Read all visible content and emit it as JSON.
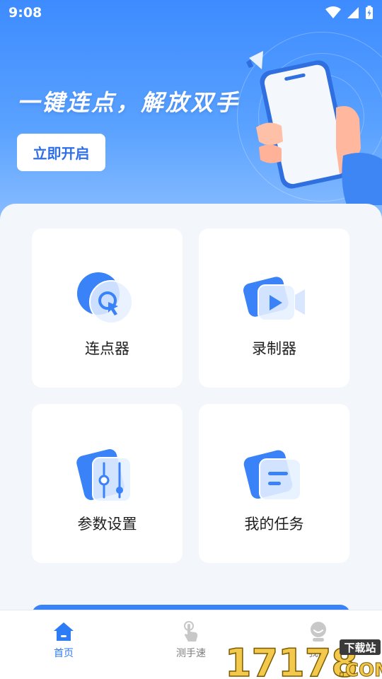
{
  "status_bar": {
    "time": "9:08"
  },
  "hero": {
    "title": "一键连点，解放双手",
    "start_button": "立即开启"
  },
  "features": [
    {
      "label": "连点器",
      "icon": "cursor-click-icon"
    },
    {
      "label": "录制器",
      "icon": "video-camera-icon"
    },
    {
      "label": "参数设置",
      "icon": "settings-slider-icon"
    },
    {
      "label": "我的任务",
      "icon": "task-list-icon"
    }
  ],
  "nav": {
    "items": [
      {
        "label": "首页",
        "icon": "home-icon",
        "active": true
      },
      {
        "label": "测手速",
        "icon": "tap-hand-icon",
        "active": false
      },
      {
        "label": "我的",
        "icon": "profile-icon",
        "active": false
      }
    ]
  },
  "watermark": {
    "text": "17178",
    "badge": "下载站",
    "suffix": ".COM"
  },
  "colors": {
    "primary": "#2e7bf6",
    "hero_top": "#3d8bff",
    "background": "#f3f6fb"
  }
}
